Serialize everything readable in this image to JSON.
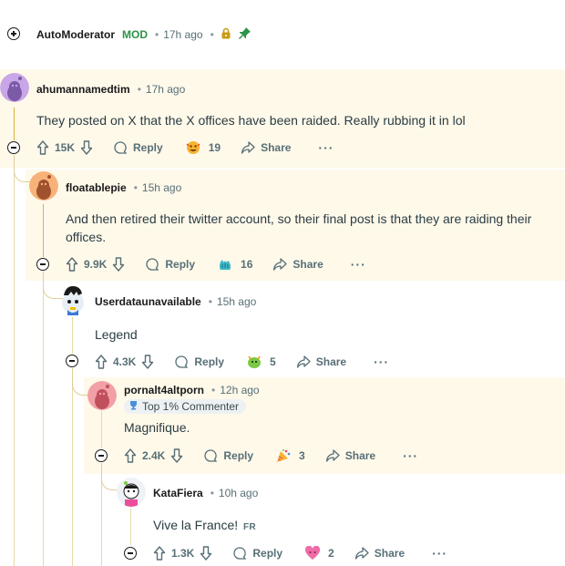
{
  "automod": {
    "author": "AutoModerator",
    "mod_tag": "MOD",
    "time": "17h ago"
  },
  "comments": [
    {
      "author": "ahumannamedtim",
      "time": "17h ago",
      "text": "They posted on X that the X offices have been raided. Really rubbing it in lol",
      "votes": "15K",
      "reply": "Reply",
      "award_count": "19",
      "share": "Share",
      "more": "···"
    },
    {
      "author": "floatablepie",
      "time": "15h ago",
      "text": "And then retired their twitter account, so their final post is that they are raiding their offices.",
      "votes": "9.9K",
      "reply": "Reply",
      "award_count": "16",
      "share": "Share",
      "more": "···"
    },
    {
      "author": "Userdataunavailable",
      "time": "15h ago",
      "text": "Legend",
      "votes": "4.3K",
      "reply": "Reply",
      "award_count": "5",
      "share": "Share",
      "more": "···"
    },
    {
      "author": "pornalt4altporn",
      "time": "12h ago",
      "badge": "Top 1% Commenter",
      "text": "Magnifique.",
      "votes": "2.4K",
      "reply": "Reply",
      "award_count": "3",
      "share": "Share",
      "more": "···"
    },
    {
      "author": "KataFiera",
      "time": "10h ago",
      "text": "Vive la France!",
      "flag": "FR",
      "votes": "1.3K",
      "reply": "Reply",
      "award_count": "2",
      "share": "Share",
      "more": "···"
    }
  ],
  "colors": {
    "highlight_bg": "#fff9ea",
    "mod_green": "#2b9348",
    "thread_gold": "#d6b23a",
    "meta_text": "#576f76"
  }
}
